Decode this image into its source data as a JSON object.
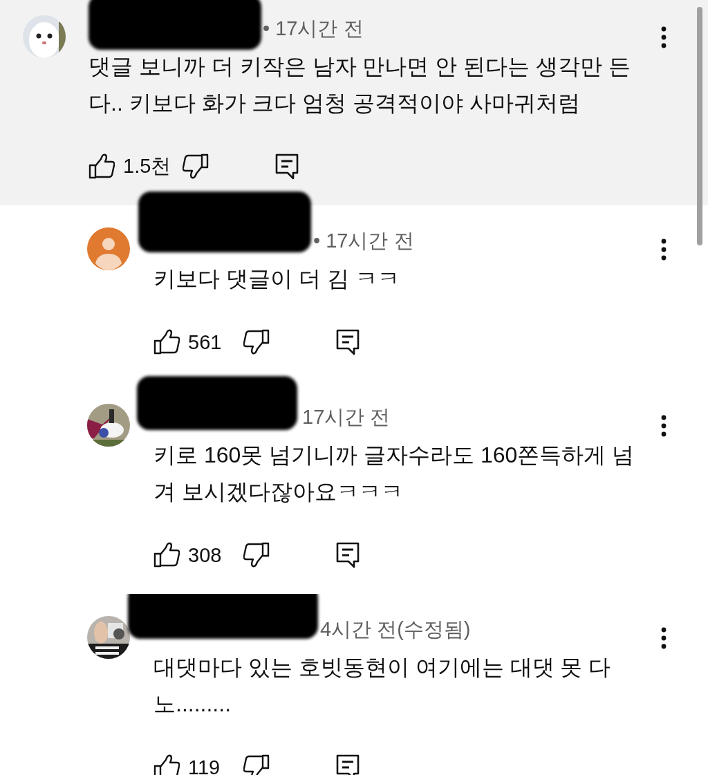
{
  "comments": [
    {
      "highlighted": true,
      "meta": "• 17시간 전",
      "text": "댓글 보니까 더 키작은 남자 만나면 안 된다는 생각만 든다.. 키보다 화가 크다 엄청 공격적이야 사마귀처럼",
      "likes": "1.5천",
      "replies": [
        {
          "highlighted": false,
          "avatar": {
            "kind": "default",
            "color": "#e07a30"
          },
          "meta": "• 17시간 전",
          "text": "키보다 댓글이 더 김 ㅋㅋ",
          "likes": "561"
        },
        {
          "highlighted": false,
          "meta": "17시간 전",
          "text": "키로 160못 넘기니까 글자수라도 160쫀득하게 넘겨 보시겠다잖아요ㅋㅋㅋ",
          "likes": "308"
        },
        {
          "highlighted": false,
          "meta": "4시간 전(수정됨)",
          "text": "대댓마다 있는 호빗동현이 여기에는 대댓 못 다노.........",
          "likes": "119"
        }
      ]
    }
  ]
}
